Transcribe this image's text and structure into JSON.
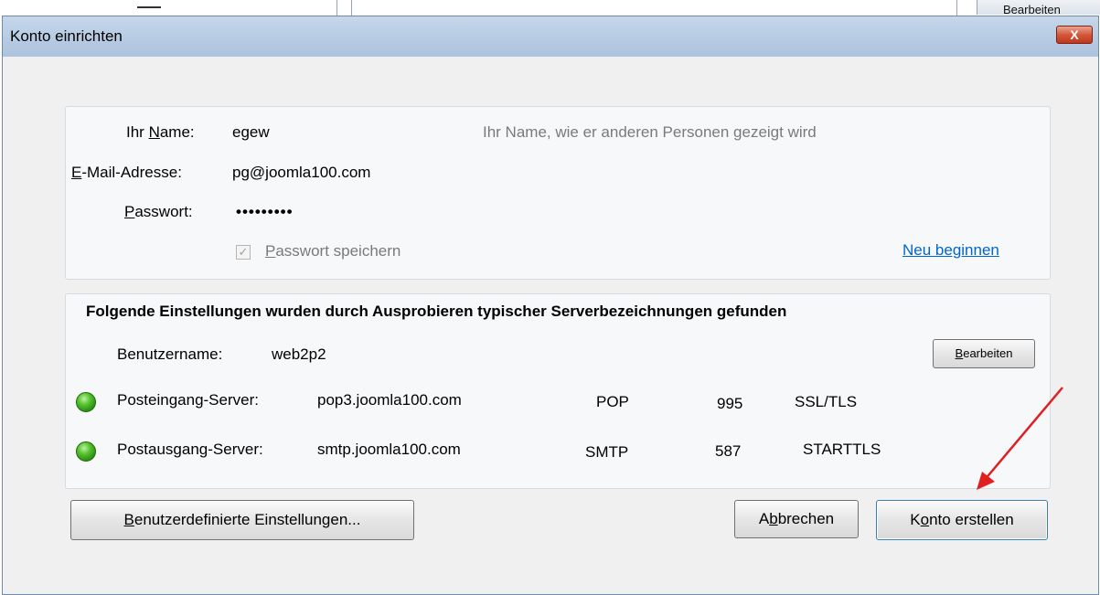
{
  "background": {
    "tab_label": "Bearbeiten"
  },
  "window": {
    "title": "Konto einrichten",
    "close_glyph": "X"
  },
  "account": {
    "name_label_pre": "Ihr ",
    "name_label_key": "N",
    "name_label_post": "ame:",
    "name_value": "egew",
    "name_hint": "Ihr Name, wie er anderen Personen gezeigt wird",
    "email_label_key": "E",
    "email_label_post": "-Mail-Adresse:",
    "email_value": "pg@joomla100.com",
    "password_label_key": "P",
    "password_label_post": "asswort:",
    "password_value": "•••••••••",
    "save_password_key": "P",
    "save_password_post": "asswort speichern",
    "save_password_checked": true,
    "restart_link": "Neu beginnen"
  },
  "found_settings": {
    "heading": "Folgende Einstellungen wurden durch Ausprobieren typischer Serverbezeichnungen gefunden",
    "username_label": "Benutzername:",
    "username_value": "web2p2",
    "edit_button_key": "B",
    "edit_button_post": "earbeiten",
    "servers": [
      {
        "label": "Posteingang-Server:",
        "host": "pop3.joomla100.com",
        "protocol": "POP",
        "port": "995",
        "security": "SSL/TLS",
        "status_color": "#3aa821"
      },
      {
        "label": "Postausgang-Server:",
        "host": "smtp.joomla100.com",
        "protocol": "SMTP",
        "port": "587",
        "security": "STARTTLS",
        "status_color": "#3aa821"
      }
    ]
  },
  "buttons": {
    "custom_key": "B",
    "custom_post": "enutzerdefinierte Einstellungen...",
    "cancel_pre": "A",
    "cancel_key": "b",
    "cancel_post": "brechen",
    "create_pre": "K",
    "create_key": "o",
    "create_post": "nto erstellen"
  },
  "annotation": {
    "arrow_color": "#e02020"
  }
}
